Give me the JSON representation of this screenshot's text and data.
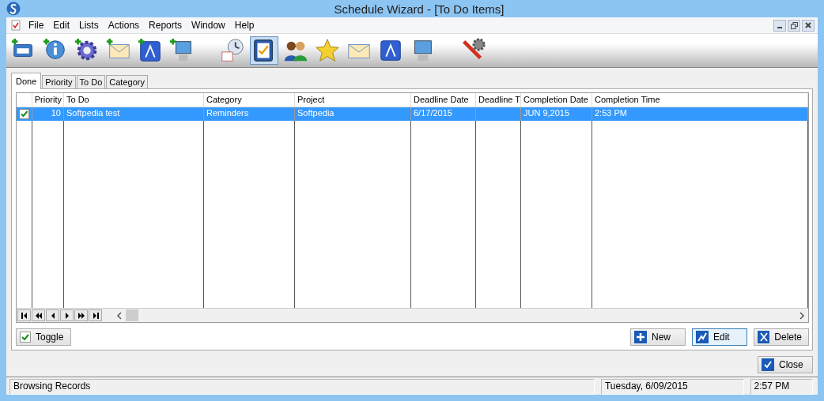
{
  "window": {
    "title": "Schedule Wizard - [To Do Items]"
  },
  "menu": [
    "File",
    "Edit",
    "Lists",
    "Actions",
    "Reports",
    "Window",
    "Help"
  ],
  "toolbar": {
    "groups": [
      [
        {
          "selected": false
        },
        {
          "selected": false
        },
        {
          "selected": false
        },
        {
          "selected": false
        },
        {
          "selected": false
        },
        {
          "selected": false
        }
      ],
      [
        {
          "selected": false
        },
        {
          "selected": true
        },
        {
          "selected": false
        },
        {
          "selected": false
        },
        {
          "selected": false
        },
        {
          "selected": false
        },
        {
          "selected": false
        }
      ],
      [
        {
          "selected": false
        }
      ]
    ]
  },
  "tabs": [
    {
      "label": "Done",
      "selected": true
    },
    {
      "label": "Priority",
      "selected": false
    },
    {
      "label": "To Do",
      "selected": false
    },
    {
      "label": "Category",
      "selected": false
    }
  ],
  "table": {
    "columns": [
      "Priority",
      "To Do",
      "Category",
      "Project",
      "Deadline Date",
      "Deadline T",
      "Completion Date",
      "Completion Time"
    ],
    "rows": [
      {
        "checked": true,
        "selected": true,
        "cells": [
          "10",
          "Softpedia test",
          "Reminders",
          "Softpedia",
          "6/17/2015",
          "",
          "JUN  9,2015",
          "2:53 PM"
        ]
      }
    ]
  },
  "buttons": {
    "toggle": "Toggle",
    "new": "New",
    "edit": "Edit",
    "delete": "Delete",
    "close": "Close"
  },
  "status_bar": [
    "Browsing Records",
    "Tuesday,  6/09/2015",
    "2:57 PM"
  ]
}
